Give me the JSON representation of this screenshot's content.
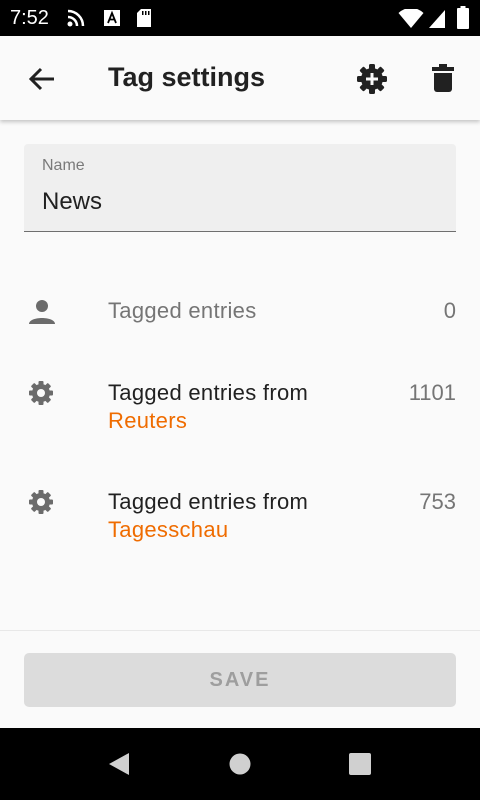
{
  "status_bar": {
    "time": "7:52",
    "icons": [
      "cast-icon",
      "a-notification-icon",
      "sd-card-icon",
      "wifi-icon",
      "signal-icon",
      "battery-icon"
    ]
  },
  "appbar": {
    "title": "Tag settings",
    "back_icon": "arrow-back-icon",
    "actions": [
      "add-settings-icon",
      "trash-icon"
    ]
  },
  "name_field": {
    "label": "Name",
    "value": "News"
  },
  "rows": [
    {
      "icon": "person-icon",
      "title": "Tagged entries",
      "subtitle": "",
      "count": "0"
    },
    {
      "icon": "gear-icon",
      "title": "Tagged entries from",
      "subtitle": "Reuters",
      "count": "1101"
    },
    {
      "icon": "gear-icon",
      "title": "Tagged entries from",
      "subtitle": "Tagesschau",
      "count": "753"
    }
  ],
  "save_button": {
    "label": "SAVE",
    "enabled": false
  },
  "colors": {
    "accent": "#ef6c00",
    "status_bar": "#000000",
    "background": "#fafafa",
    "disabled_button": "#dcdcdc"
  }
}
